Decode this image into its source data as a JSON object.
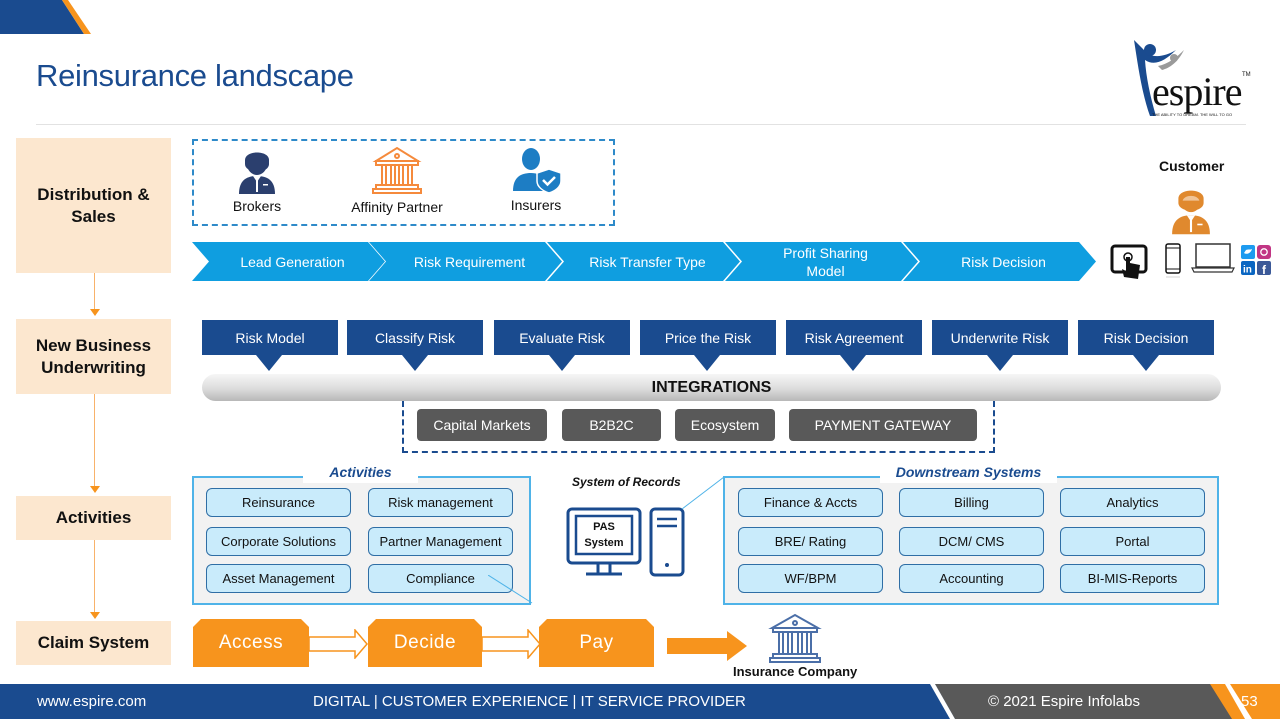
{
  "header": {
    "title": "Reinsurance landscape",
    "logo_text": "espire",
    "logo_tm": "TM",
    "logo_tagline": "THE ABILITY TO DREAM. THE WILL TO GO"
  },
  "colors": {
    "brand_blue": "#1a4b8f",
    "chevron_blue": "#0f9ee0",
    "accent_orange": "#f7941d",
    "stage_bg": "#fce7cf",
    "integration_dark": "#595959",
    "pill_bg": "#c9ebfb",
    "footer_gray": "#595959"
  },
  "stages": [
    {
      "label": "Distribution & Sales"
    },
    {
      "label": "New Business Underwriting"
    },
    {
      "label": "Activities"
    },
    {
      "label": "Claim System"
    }
  ],
  "distribution": {
    "parties": [
      {
        "label": "Brokers",
        "icon": "broker-icon"
      },
      {
        "label": "Affinity Partner",
        "icon": "bank-building-icon"
      },
      {
        "label": "Insurers",
        "icon": "user-shield-icon"
      }
    ],
    "chevrons": [
      {
        "label": "Lead Generation"
      },
      {
        "label": "Risk Requirement"
      },
      {
        "label": "Risk Transfer Type"
      },
      {
        "label": "Profit Sharing Model"
      },
      {
        "label": "Risk Decision"
      }
    ],
    "customer": {
      "label": "Customer",
      "channels": [
        "tablet-touch-icon",
        "smartphone-icon",
        "laptop-icon",
        "social-media-icon"
      ]
    }
  },
  "underwriting": {
    "steps": [
      {
        "label": "Risk Model"
      },
      {
        "label": "Classify Risk"
      },
      {
        "label": "Evaluate Risk"
      },
      {
        "label": "Price the Risk"
      },
      {
        "label": "Risk Agreement"
      },
      {
        "label": "Underwrite Risk"
      },
      {
        "label": "Risk Decision"
      }
    ],
    "integrations_label": "INTEGRATIONS",
    "integrations": [
      {
        "label": "Capital Markets"
      },
      {
        "label": "B2B2C"
      },
      {
        "label": "Ecosystem"
      },
      {
        "label": "PAYMENT GATEWAY"
      }
    ]
  },
  "activities": {
    "title": "Activities",
    "items": [
      {
        "label": "Reinsurance"
      },
      {
        "label": "Risk management"
      },
      {
        "label": "Corporate Solutions"
      },
      {
        "label": "Partner Management"
      },
      {
        "label": "Asset Management"
      },
      {
        "label": "Compliance"
      }
    ],
    "system_of_records": {
      "label": "System of Records",
      "screen_line1": "PAS",
      "screen_line2": "System"
    },
    "downstream": {
      "title": "Downstream Systems",
      "items": [
        {
          "label": "Finance & Accts"
        },
        {
          "label": "Billing"
        },
        {
          "label": "Analytics"
        },
        {
          "label": "BRE/ Rating"
        },
        {
          "label": "DCM/ CMS"
        },
        {
          "label": "Portal"
        },
        {
          "label": "WF/BPM"
        },
        {
          "label": "Accounting"
        },
        {
          "label": "BI-MIS-Reports"
        }
      ]
    }
  },
  "claims": {
    "steps": [
      {
        "label": "Access"
      },
      {
        "label": "Decide"
      },
      {
        "label": "Pay"
      }
    ],
    "destination": "Insurance Company"
  },
  "footer": {
    "website": "www.espire.com",
    "tagline": "DIGITAL | CUSTOMER EXPERIENCE | IT SERVICE PROVIDER",
    "copyright": "© 2021 Espire Infolabs",
    "page_number": "53"
  }
}
